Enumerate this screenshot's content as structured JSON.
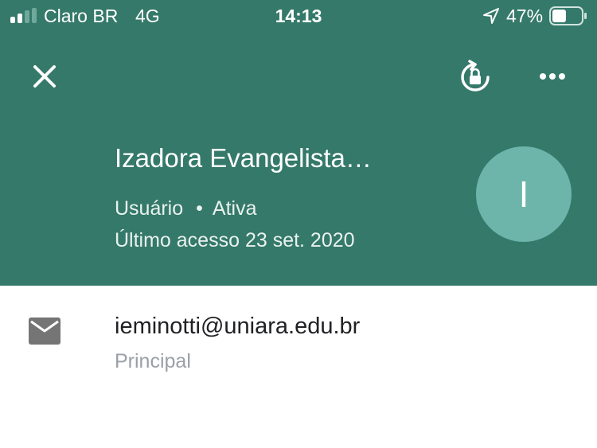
{
  "colors": {
    "header_bg": "#35796a",
    "avatar_bg": "#6db5aa",
    "text_primary": "#202124",
    "text_secondary": "#9aa0a6"
  },
  "status_bar": {
    "carrier": "Claro BR",
    "network": "4G",
    "time": "14:13",
    "battery_percent": "47%",
    "battery_level": 0.47,
    "signal_bars_filled": 2,
    "signal_bars_total": 4
  },
  "toolbar": {
    "close_icon": "close-icon",
    "lock_icon": "lock-reset-icon",
    "more_icon": "more-horizontal-icon"
  },
  "profile": {
    "name": "Izadora Evangelista…",
    "role": "Usuário",
    "separator": "•",
    "status": "Ativa",
    "last_access": "Último acesso 23 set. 2020",
    "avatar_letter": "I"
  },
  "contact": {
    "email": "ieminotti@uniara.edu.br",
    "email_label": "Principal",
    "icon": "mail-icon"
  }
}
